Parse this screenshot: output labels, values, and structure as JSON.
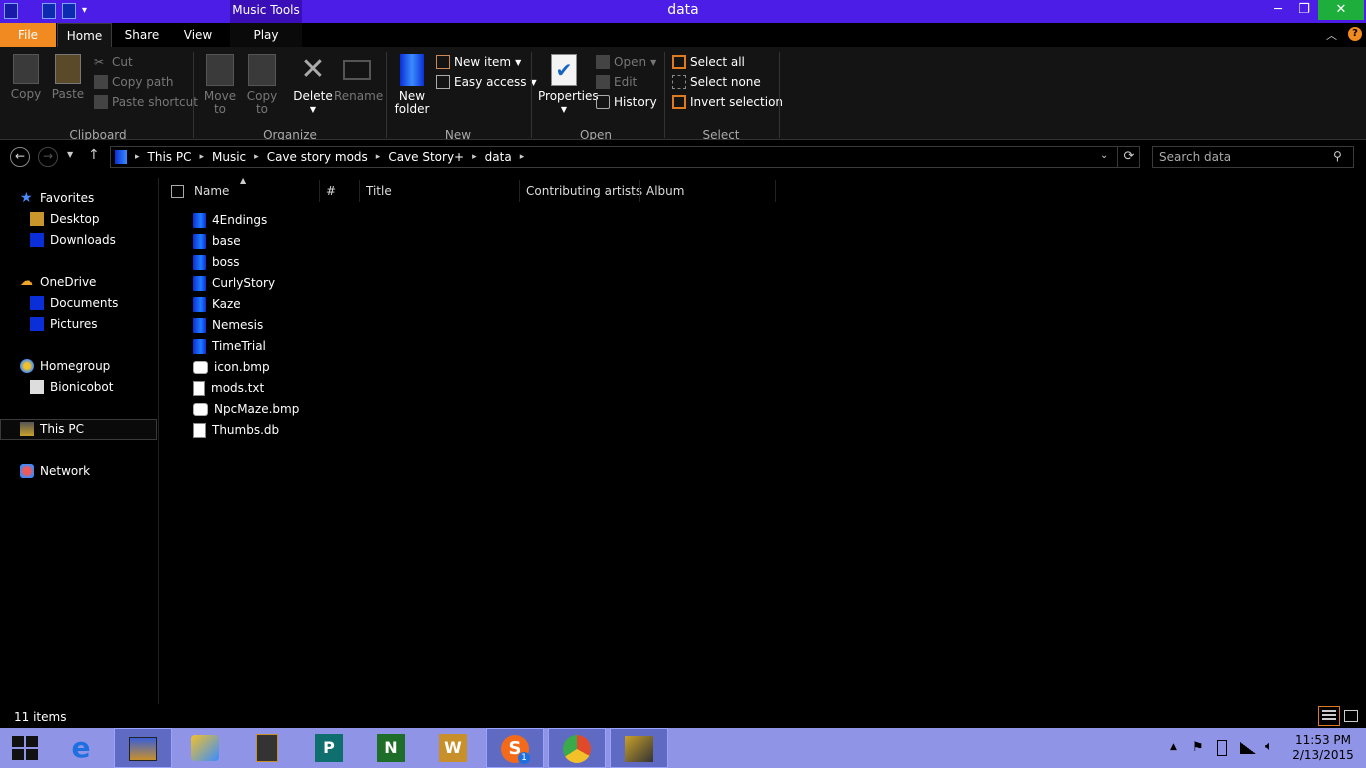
{
  "window": {
    "title": "data",
    "contextual_tab": "Music Tools",
    "controls": {
      "minimize": "─",
      "maximize": "❐",
      "close": "✕"
    }
  },
  "ribbon": {
    "tabs": [
      "File",
      "Home",
      "Share",
      "View",
      "Play"
    ],
    "clipboard": {
      "copy": "Copy",
      "paste": "Paste",
      "cut": "Cut",
      "copy_path": "Copy path",
      "paste_shortcut": "Paste shortcut",
      "group": "Clipboard"
    },
    "organize": {
      "move_to_1": "Move",
      "move_to_2": "to",
      "copy_to_1": "Copy",
      "copy_to_2": "to",
      "delete": "Delete",
      "rename": "Rename",
      "group": "Organize"
    },
    "new": {
      "new_folder_1": "New",
      "new_folder_2": "folder",
      "new_item": "New item",
      "easy_access": "Easy access",
      "group": "New"
    },
    "open": {
      "properties": "Properties",
      "open": "Open",
      "edit": "Edit",
      "history": "History",
      "group": "Open"
    },
    "select": {
      "select_all": "Select all",
      "select_none": "Select none",
      "invert": "Invert selection",
      "group": "Select"
    }
  },
  "address": {
    "crumbs": [
      "This PC",
      "Music",
      "Cave story mods",
      "Cave Story+",
      "data"
    ],
    "search_placeholder": "Search data"
  },
  "nav": {
    "favorites": "Favorites",
    "desktop": "Desktop",
    "downloads": "Downloads",
    "onedrive": "OneDrive",
    "documents": "Documents",
    "pictures": "Pictures",
    "homegroup": "Homegroup",
    "bionicobot": "Bionicobot",
    "thispc": "This PC",
    "network": "Network"
  },
  "columns": {
    "name": "Name",
    "number": "#",
    "title": "Title",
    "artists": "Contributing artists",
    "album": "Album"
  },
  "files": [
    {
      "name": "4Endings",
      "type": "folder"
    },
    {
      "name": "base",
      "type": "folder"
    },
    {
      "name": "boss",
      "type": "folder"
    },
    {
      "name": "CurlyStory",
      "type": "folder"
    },
    {
      "name": "Kaze",
      "type": "folder"
    },
    {
      "name": "Nemesis",
      "type": "folder"
    },
    {
      "name": "TimeTrial",
      "type": "folder"
    },
    {
      "name": "icon.bmp",
      "type": "bmp"
    },
    {
      "name": "mods.txt",
      "type": "txt"
    },
    {
      "name": "NpcMaze.bmp",
      "type": "bmp"
    },
    {
      "name": "Thumbs.db",
      "type": "db"
    }
  ],
  "status": {
    "count": "11 items"
  },
  "taskbar": {
    "time": "11:53 PM",
    "date": "2/13/2015",
    "skype_badge": "1"
  }
}
